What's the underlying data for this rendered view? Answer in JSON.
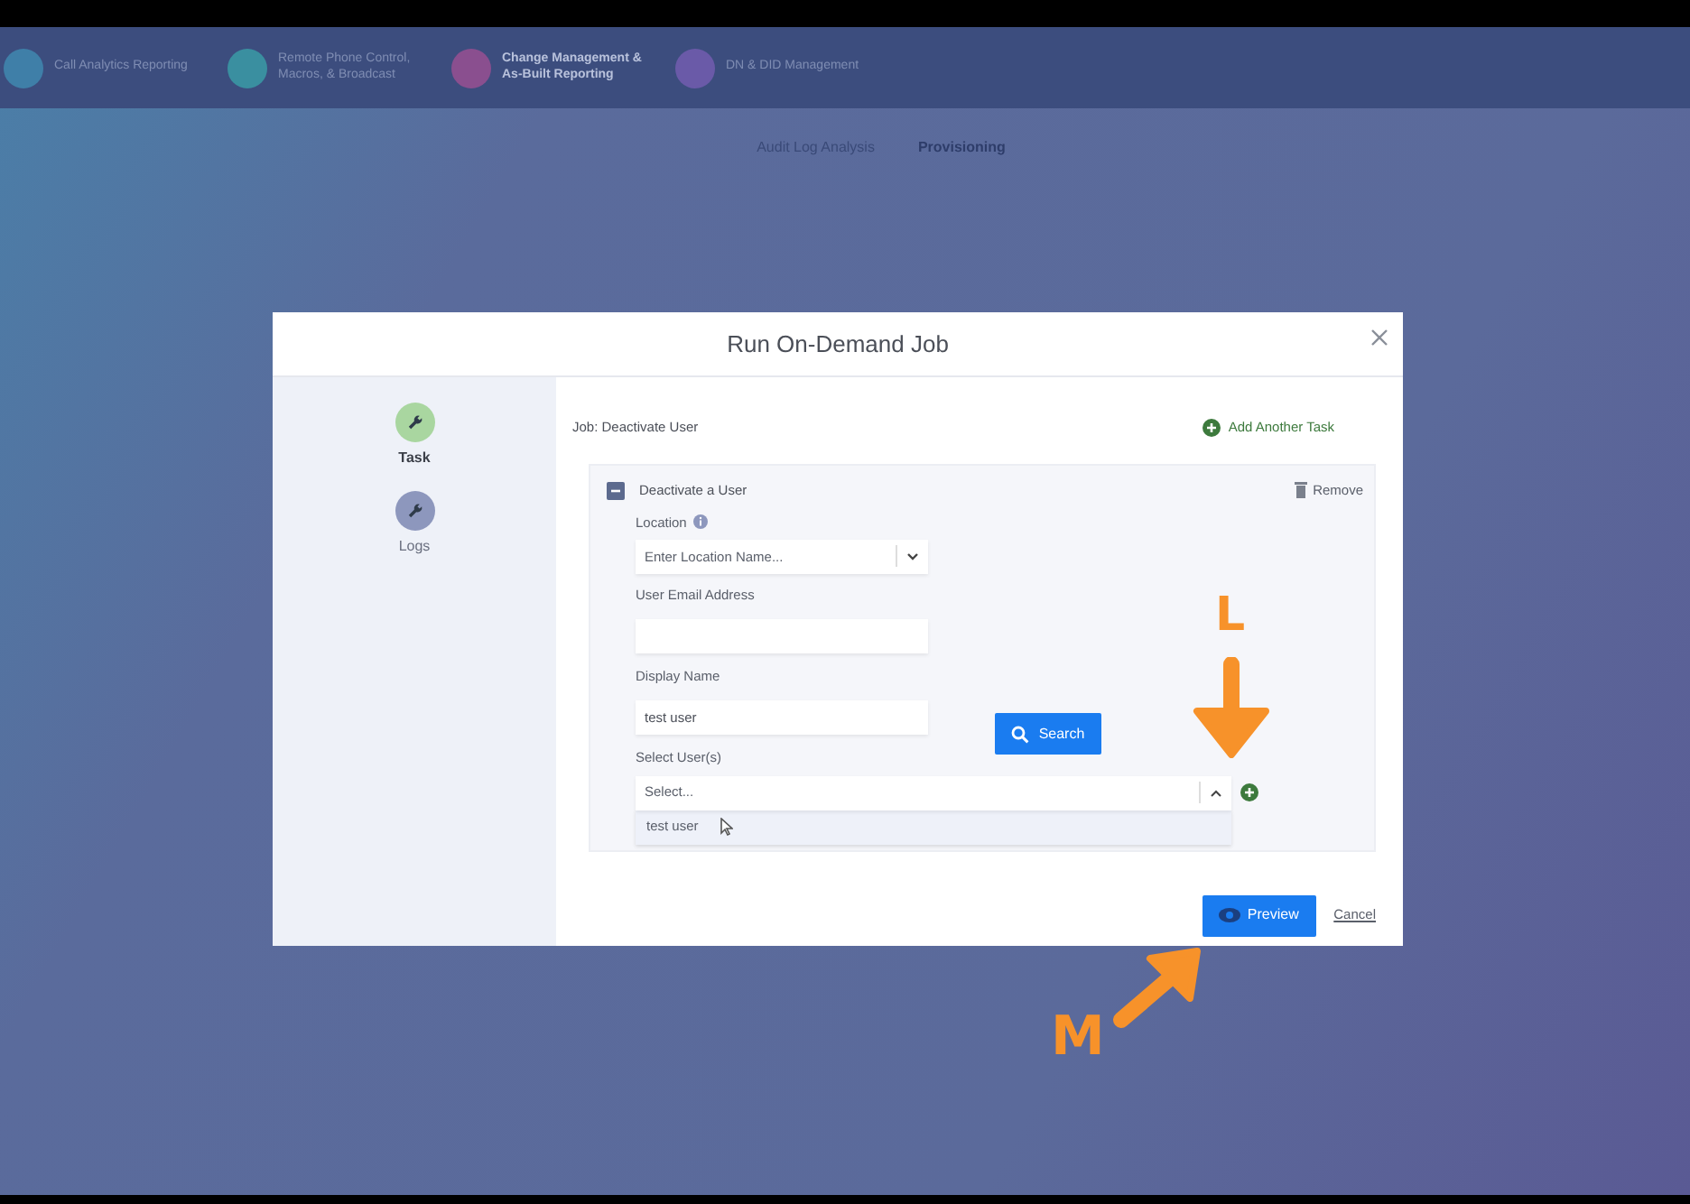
{
  "top_nav": {
    "items": [
      {
        "label": "Call Analytics Reporting",
        "selected": false,
        "color": "#3f7fa8"
      },
      {
        "label": "Remote Phone Control, Macros, & Broadcast",
        "selected": false,
        "color": "#3a8fa0"
      },
      {
        "label": "Change Management & As-Built Reporting",
        "selected": true,
        "color": "#8a4f8f"
      },
      {
        "label": "DN & DID Management",
        "selected": false,
        "color": "#6a5aa8"
      }
    ]
  },
  "sub_tabs": [
    {
      "label": "Audit Log Analysis",
      "selected": false
    },
    {
      "label": "Provisioning",
      "selected": true
    }
  ],
  "modal": {
    "title": "Run On-Demand Job",
    "steps": [
      {
        "label": "Task",
        "selected": true
      },
      {
        "label": "Logs",
        "selected": false
      }
    ],
    "job_label": "Job: Deactivate User",
    "add_task": "Add Another Task",
    "task": {
      "title": "Deactivate a User",
      "expanded": true,
      "remove": "Remove",
      "fields": [
        {
          "kind": "select",
          "label": "Location",
          "info": true,
          "placeholder": "Enter Location Name..."
        },
        {
          "kind": "text",
          "label": "User Email Address"
        },
        {
          "kind": "text",
          "label": "Display Name",
          "value": "test user"
        }
      ],
      "search_button": "Search",
      "select_users": {
        "label": "Select User(s)",
        "placeholder": "Select...",
        "open": true,
        "options": [
          "test user"
        ]
      }
    },
    "preview_button": "Preview",
    "cancel": "Cancel"
  },
  "annotations": [
    {
      "label": "L",
      "kind": "down"
    },
    {
      "label": "M",
      "kind": "diagonal"
    }
  ]
}
